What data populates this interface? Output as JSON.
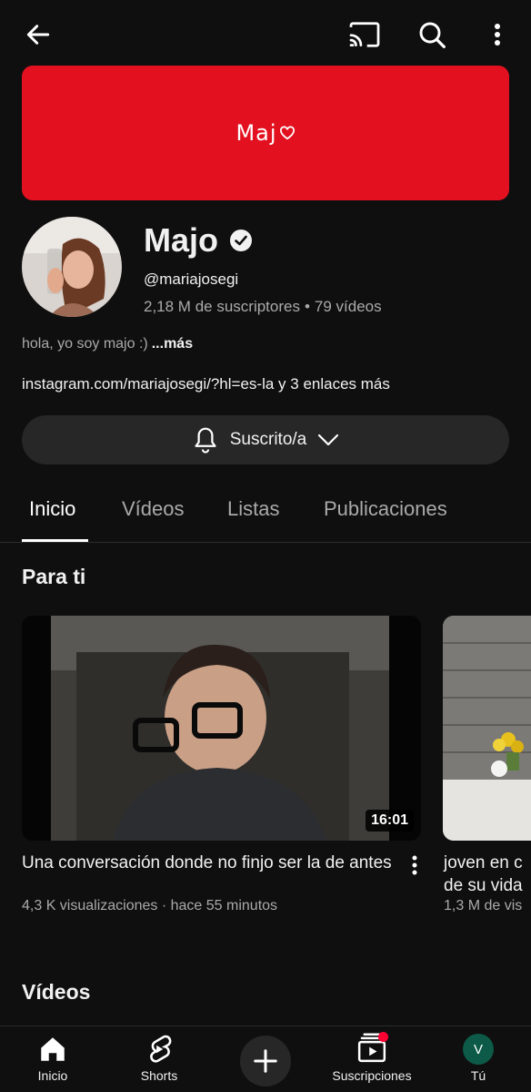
{
  "topbar": {
    "back_icon": "arrow-left-icon",
    "cast_icon": "cast-icon",
    "search_icon": "search-icon",
    "more_icon": "more-vertical-icon"
  },
  "banner": {
    "text": "Maj",
    "color": "#e3101f"
  },
  "channel": {
    "name": "Majo",
    "handle": "@mariajosegi",
    "subscribers": "2,18 M de suscriptores",
    "videos_count": "79 vídeos",
    "description": "hola, yo soy majo :)",
    "more_label": "...más",
    "link": "instagram.com/mariajosegi/?hl=es-la",
    "extra_links": "y 3 enlaces más"
  },
  "subscribe": {
    "label": "Suscrito/a"
  },
  "tabs": [
    {
      "label": "Inicio",
      "active": true
    },
    {
      "label": "Vídeos"
    },
    {
      "label": "Listas"
    },
    {
      "label": "Publicaciones"
    }
  ],
  "for_you": {
    "title": "Para ti",
    "videos": [
      {
        "title": "Una conversación donde no finjo ser la de antes",
        "meta": "4,3 K visualizaciones · hace 55 minutos",
        "duration": "16:01"
      },
      {
        "title": "joven en c",
        "title_line2": "de su vida",
        "meta": "1,3 M de vis"
      }
    ]
  },
  "videos_section": {
    "title": "Vídeos"
  },
  "navbar": {
    "items": [
      {
        "label": "Inicio",
        "icon": "home-icon"
      },
      {
        "label": "Shorts",
        "icon": "shorts-icon"
      },
      {
        "label": "",
        "icon": "plus-icon"
      },
      {
        "label": "Suscripciones",
        "icon": "subscriptions-icon"
      },
      {
        "label": "Tú",
        "avatar_letter": "V"
      }
    ]
  }
}
